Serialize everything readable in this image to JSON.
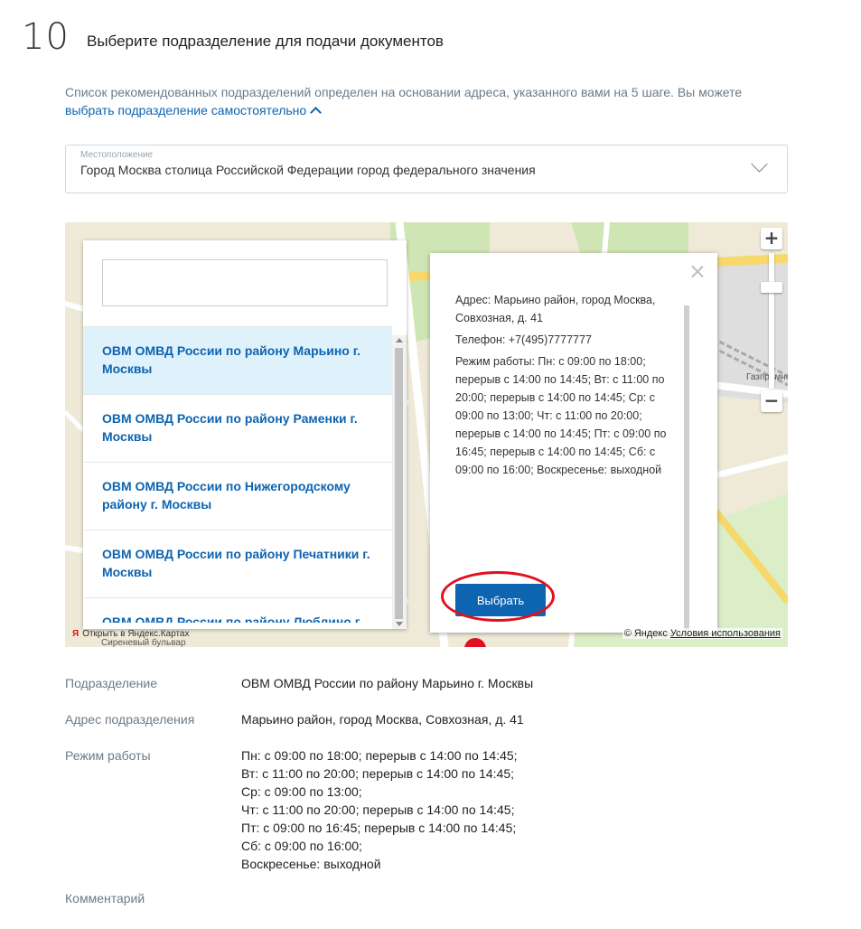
{
  "step": {
    "number": "10",
    "title": "Выберите подразделение для подачи документов"
  },
  "info": {
    "text": "Список рекомендованных подразделений определен на основании адреса, указанного вами на 5 шаге. Вы можете",
    "link": "выбрать подразделение самостоятельно"
  },
  "location": {
    "label": "Местоположение",
    "value": "Город Москва столица Российской Федерации город федерального значения"
  },
  "map": {
    "search_placeholder": "",
    "list": [
      {
        "name": "ОВМ ОМВД России по району Марьино г. Москвы"
      },
      {
        "name": "ОВМ ОМВД России по району Раменки г. Москвы"
      },
      {
        "name": "ОВМ ОМВД России по Нижегородскому району г. Москвы"
      },
      {
        "name": "ОВМ ОМВД России по району Печатники г. Москвы"
      },
      {
        "name": "ОВМ ОМВД России по району Люблино г."
      }
    ],
    "balloon": {
      "address": "Адрес: Марьино район, город Москва, Совхозная, д. 41",
      "phone": "Телефон: +7(495)7777777",
      "schedule": "Режим работы: Пн: с 09:00 по 18:00; перерыв с 14:00 по 14:45; Вт: с 11:00 по 20:00; перерыв с 14:00 по 14:45; Ср: с 09:00 по 13:00; Чт: с 11:00 по 20:00; перерыв с 14:00 по 14:45; Пт: с 09:00 по 16:45; перерыв с 14:00 по 14:45; Сб: с 09:00 по 16:00; Воскресенье: выходной",
      "button": "Выбрать"
    },
    "copyright": "© Яндекс",
    "terms": "Условия использования",
    "open_in": "Открыть в Яндекс.Картах",
    "labels": {
      "gazprom": "Газпромнефть",
      "street": "Сиреневый бульвар"
    }
  },
  "details": {
    "dept_label": "Подразделение",
    "dept_value": "ОВМ ОМВД России по району Марьино г. Москвы",
    "addr_label": "Адрес подразделения",
    "addr_value": "Марьино район, город Москва, Совхозная, д. 41",
    "hours_label": "Режим работы",
    "hours": [
      "Пн: с 09:00 по 18:00; перерыв с 14:00 по 14:45;",
      "Вт: с 11:00 по 20:00; перерыв с 14:00 по 14:45;",
      "Ср: с 09:00 по 13:00;",
      "Чт: с 11:00 по 20:00; перерыв с 14:00 по 14:45;",
      "Пт: с 09:00 по 16:45; перерыв с 14:00 по 14:45;",
      "Сб: с 09:00 по 16:00;",
      "Воскресенье: выходной"
    ],
    "comment_label": "Комментарий"
  }
}
